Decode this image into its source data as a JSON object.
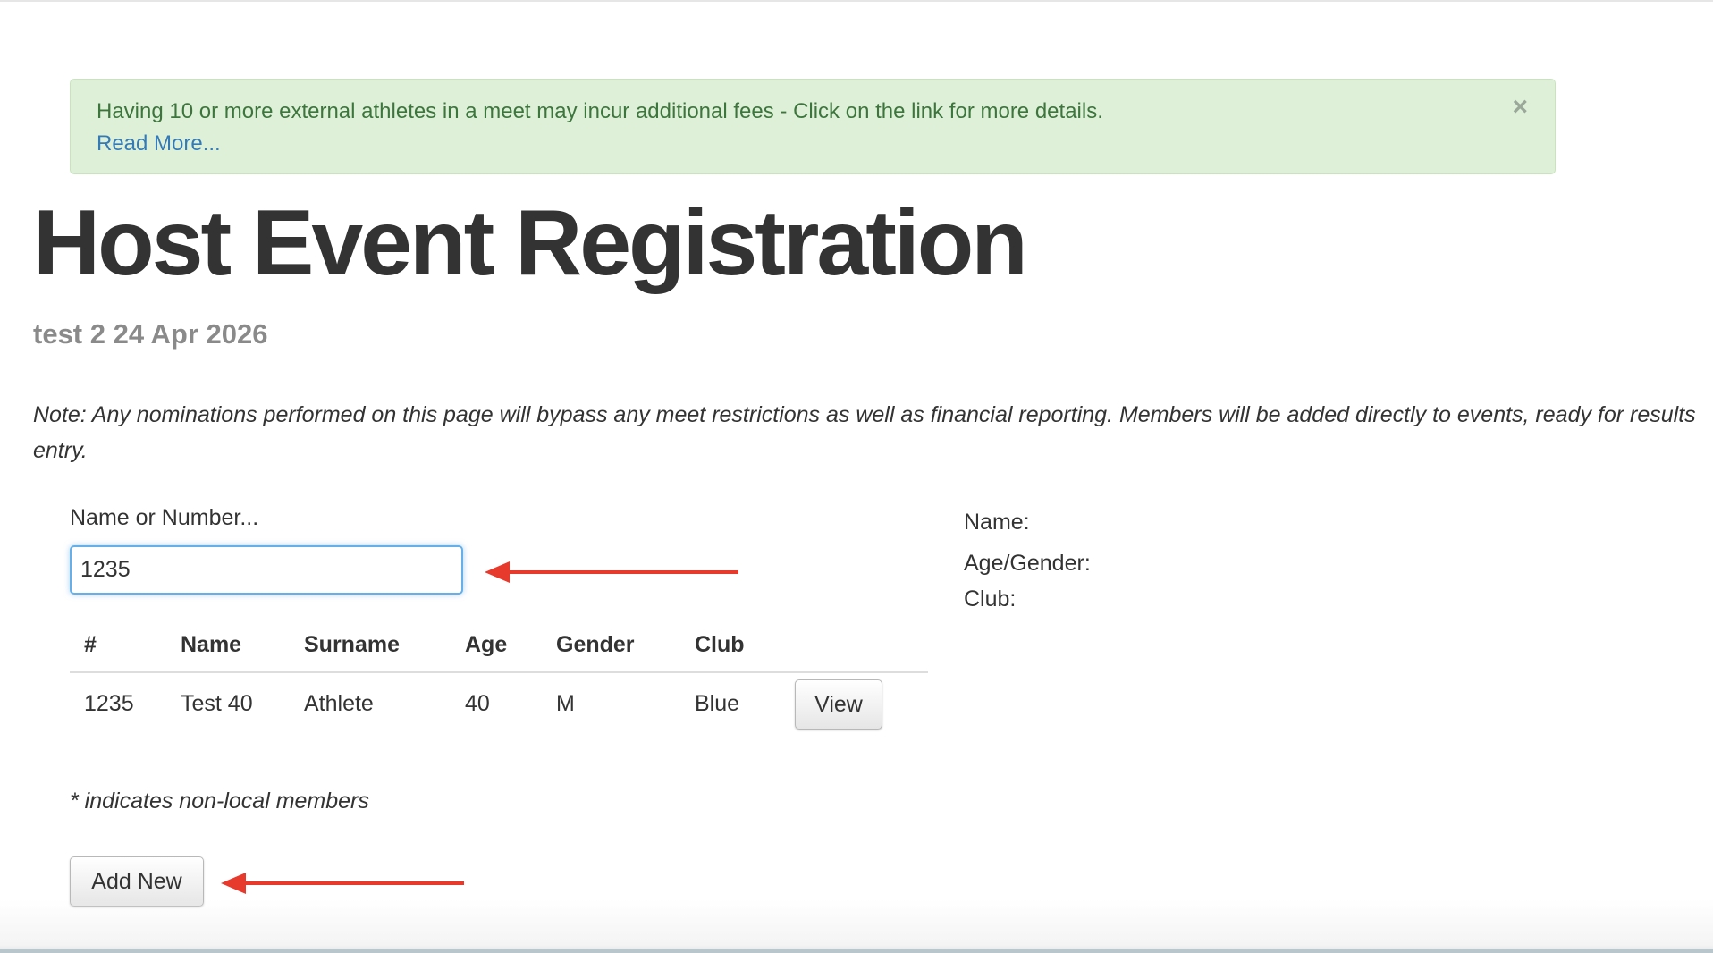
{
  "alert": {
    "message": "Having 10 or more external athletes in a meet may incur additional fees - Click on the link for more details.",
    "link_label": "Read More...",
    "close_label": "×"
  },
  "page": {
    "title": "Host Event Registration",
    "event": "test 2 24 Apr 2026",
    "note": "Note: Any nominations performed on this page will bypass any meet restrictions as well as financial reporting. Members will be added directly to events, ready for results entry."
  },
  "search": {
    "label": "Name or Number...",
    "value": "1235"
  },
  "table": {
    "headers": [
      "#",
      "Name",
      "Surname",
      "Age",
      "Gender",
      "Club"
    ],
    "rows": [
      {
        "number": "1235",
        "name": "Test 40",
        "surname": "Athlete",
        "age": "40",
        "gender": "M",
        "club": "Blue",
        "action": "View"
      }
    ]
  },
  "footnote": "* indicates non-local members",
  "add_new_label": "Add New",
  "details": {
    "name_label": "Name:",
    "age_gender_label": "Age/Gender:",
    "club_label": "Club:"
  },
  "colors": {
    "alert_bg": "#dff0d8",
    "alert_text": "#3c763d",
    "link": "#337ab7",
    "annotation_arrow": "#e8392d",
    "input_focus": "#66afe9"
  }
}
